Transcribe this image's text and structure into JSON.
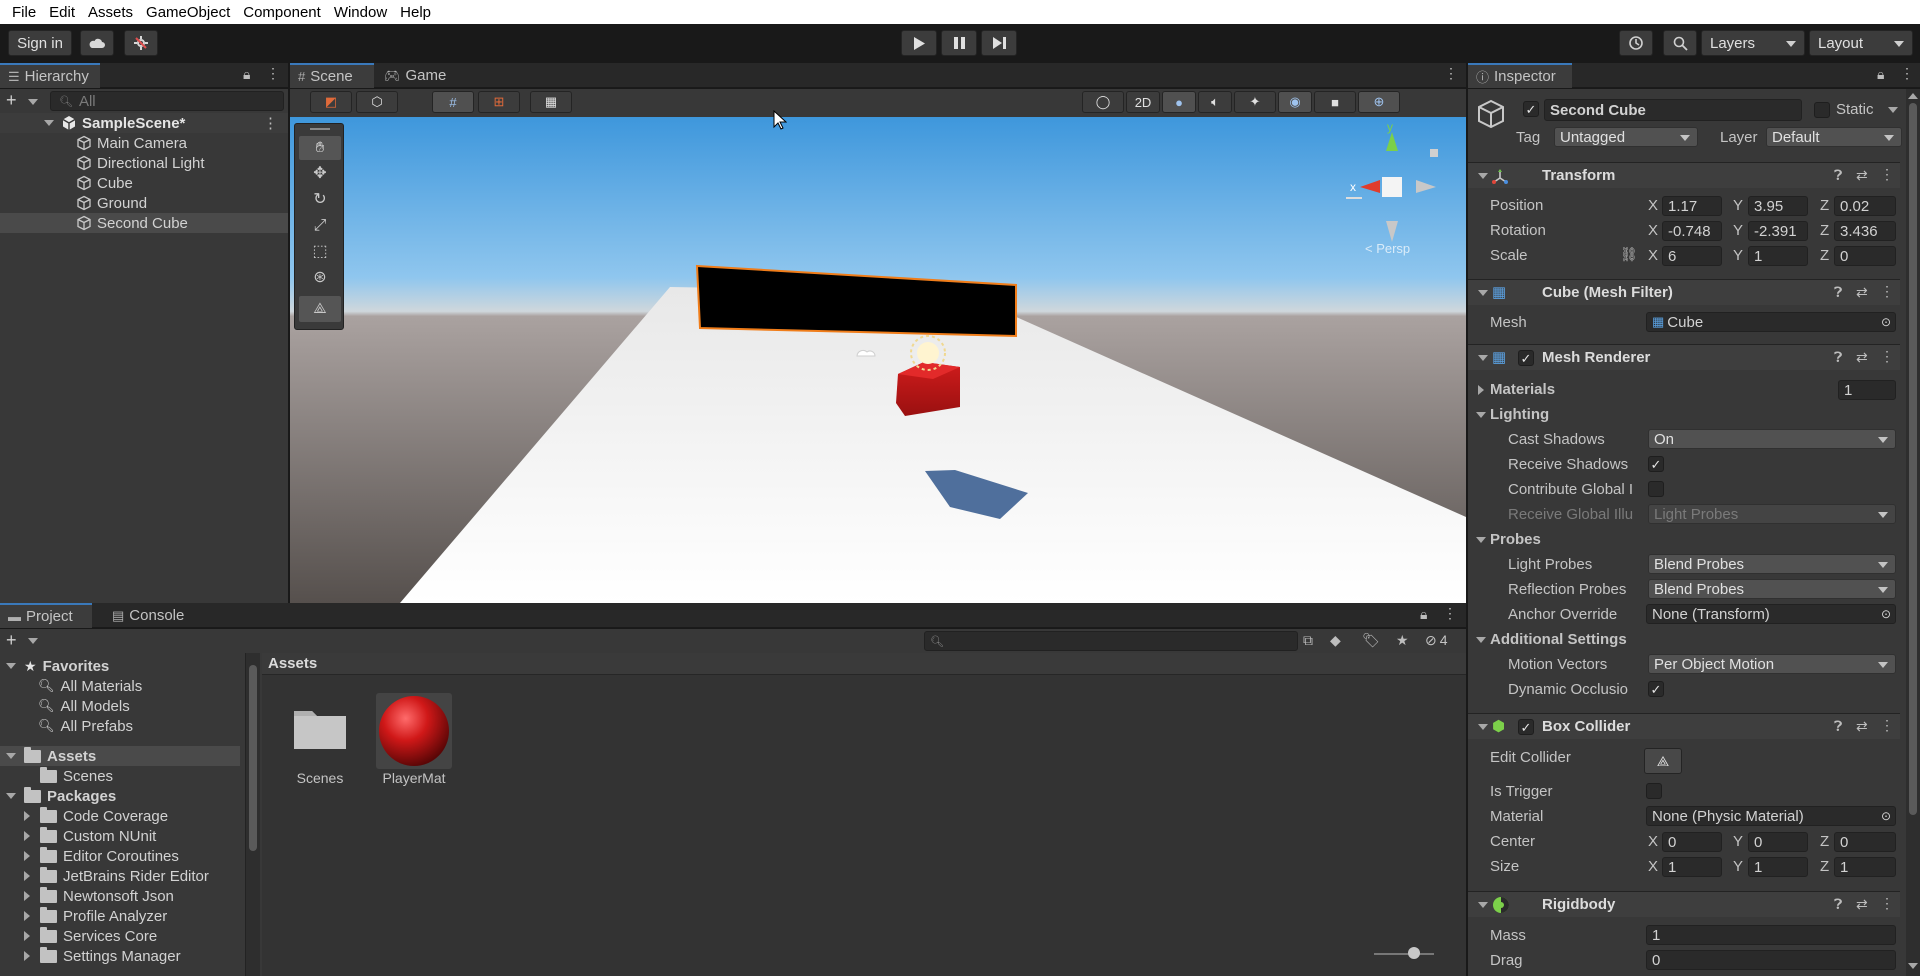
{
  "menu": [
    "File",
    "Edit",
    "Assets",
    "GameObject",
    "Component",
    "Window",
    "Help"
  ],
  "toolbar": {
    "sign_in": "Sign in",
    "layers": "Layers",
    "layout": "Layout"
  },
  "hierarchy": {
    "tab": "Hierarchy",
    "search_placeholder": "All",
    "scene": "SampleScene*",
    "items": [
      "Main Camera",
      "Directional Light",
      "Cube",
      "Ground",
      "Second Cube"
    ],
    "selected": "Second Cube"
  },
  "scene_view": {
    "tabs": [
      "Scene",
      "Game"
    ],
    "mode_2d": "2D",
    "gizmo_persp": "< Persp",
    "gizmo_axes": {
      "x": "x",
      "y": "y"
    }
  },
  "inspector": {
    "tab": "Inspector",
    "object_name": "Second Cube",
    "static_label": "Static",
    "tag_label": "Tag",
    "tag_value": "Untagged",
    "layer_label": "Layer",
    "layer_value": "Default",
    "transform": {
      "title": "Transform",
      "position_label": "Position",
      "rotation_label": "Rotation",
      "scale_label": "Scale",
      "position": {
        "x": "1.17",
        "y": "3.95",
        "z": "0.02"
      },
      "rotation": {
        "x": "-0.748",
        "y": "-2.391",
        "z": "3.436"
      },
      "scale": {
        "x": "6",
        "y": "1",
        "z": "0"
      }
    },
    "mesh_filter": {
      "title": "Cube (Mesh Filter)",
      "mesh_label": "Mesh",
      "mesh_value": "Cube"
    },
    "mesh_renderer": {
      "title": "Mesh Renderer",
      "materials_label": "Materials",
      "materials_count": "1",
      "lighting_label": "Lighting",
      "cast_shadows_label": "Cast Shadows",
      "cast_shadows_value": "On",
      "receive_shadows_label": "Receive Shadows",
      "contribute_gi_label": "Contribute Global I",
      "receive_gi_label": "Receive Global Illu",
      "receive_gi_value": "Light Probes",
      "probes_label": "Probes",
      "light_probes_label": "Light Probes",
      "light_probes_value": "Blend Probes",
      "reflection_probes_label": "Reflection Probes",
      "reflection_probes_value": "Blend Probes",
      "anchor_override_label": "Anchor Override",
      "anchor_override_value": "None (Transform)",
      "additional_settings_label": "Additional Settings",
      "motion_vectors_label": "Motion Vectors",
      "motion_vectors_value": "Per Object Motion",
      "dynamic_occlusion_label": "Dynamic Occlusio"
    },
    "box_collider": {
      "title": "Box Collider",
      "edit_collider_label": "Edit Collider",
      "is_trigger_label": "Is Trigger",
      "material_label": "Material",
      "material_value": "None (Physic Material)",
      "center_label": "Center",
      "center": {
        "x": "0",
        "y": "0",
        "z": "0"
      },
      "size_label": "Size",
      "size": {
        "x": "1",
        "y": "1",
        "z": "1"
      }
    },
    "rigidbody": {
      "title": "Rigidbody",
      "mass_label": "Mass",
      "mass_value": "1",
      "drag_label": "Drag",
      "drag_value": "0"
    },
    "axis_labels": {
      "x": "X",
      "y": "Y",
      "z": "Z"
    }
  },
  "project": {
    "tabs": [
      "Project",
      "Console"
    ],
    "hidden_count": "4",
    "favorites_label": "Favorites",
    "favorites": [
      "All Materials",
      "All Models",
      "All Prefabs"
    ],
    "assets_label": "Assets",
    "assets_children": [
      "Scenes"
    ],
    "packages_label": "Packages",
    "packages": [
      "Code Coverage",
      "Custom NUnit",
      "Editor Coroutines",
      "JetBrains Rider Editor",
      "Newtonsoft Json",
      "Profile Analyzer",
      "Services Core",
      "Settings Manager"
    ],
    "breadcrumb": "Assets",
    "asset_items": [
      "Scenes",
      "PlayerMat"
    ]
  },
  "colors": {
    "accent": "#3a79bb",
    "selection_orange": "#f07d1a",
    "red_cube": "#c41a1a"
  }
}
